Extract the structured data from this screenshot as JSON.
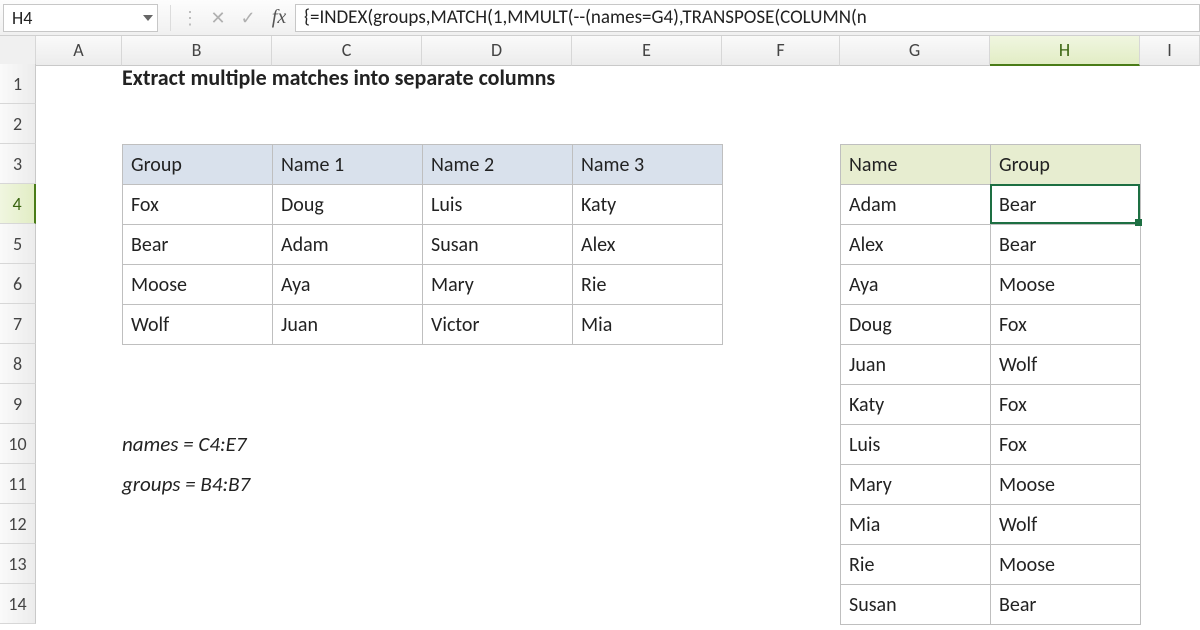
{
  "name_box": {
    "value": "H4"
  },
  "formula_bar": {
    "cancel_glyph": "✕",
    "enter_glyph": "✓",
    "fx_label": "fx",
    "formula": "{=INDEX(groups,MATCH(1,MMULT(--(names=G4),TRANSPOSE(COLUMN(n"
  },
  "columns": [
    "A",
    "B",
    "C",
    "D",
    "E",
    "F",
    "G",
    "H",
    "I"
  ],
  "selected_column": "H",
  "rows": [
    "1",
    "2",
    "3",
    "4",
    "5",
    "6",
    "7",
    "8",
    "9",
    "10",
    "11",
    "12",
    "13",
    "14"
  ],
  "selected_row": "4",
  "title": "Extract multiple matches into separate columns",
  "table1": {
    "headers": [
      "Group",
      "Name 1",
      "Name 2",
      "Name 3"
    ],
    "rows": [
      [
        "Fox",
        "Doug",
        "Luis",
        "Katy"
      ],
      [
        "Bear",
        "Adam",
        "Susan",
        "Alex"
      ],
      [
        "Moose",
        "Aya",
        "Mary",
        "Rie"
      ],
      [
        "Wolf",
        "Juan",
        "Victor",
        "Mia"
      ]
    ]
  },
  "table2": {
    "headers": [
      "Name",
      "Group"
    ],
    "rows": [
      [
        "Adam",
        "Bear"
      ],
      [
        "Alex",
        "Bear"
      ],
      [
        "Aya",
        "Moose"
      ],
      [
        "Doug",
        "Fox"
      ],
      [
        "Juan",
        "Wolf"
      ],
      [
        "Katy",
        "Fox"
      ],
      [
        "Luis",
        "Fox"
      ],
      [
        "Mary",
        "Moose"
      ],
      [
        "Mia",
        "Wolf"
      ],
      [
        "Rie",
        "Moose"
      ],
      [
        "Susan",
        "Bear"
      ]
    ]
  },
  "notes": {
    "line1": "names = C4:E7",
    "line2": "groups = B4:B7"
  },
  "active_cell": {
    "col": "H",
    "row": 4
  }
}
